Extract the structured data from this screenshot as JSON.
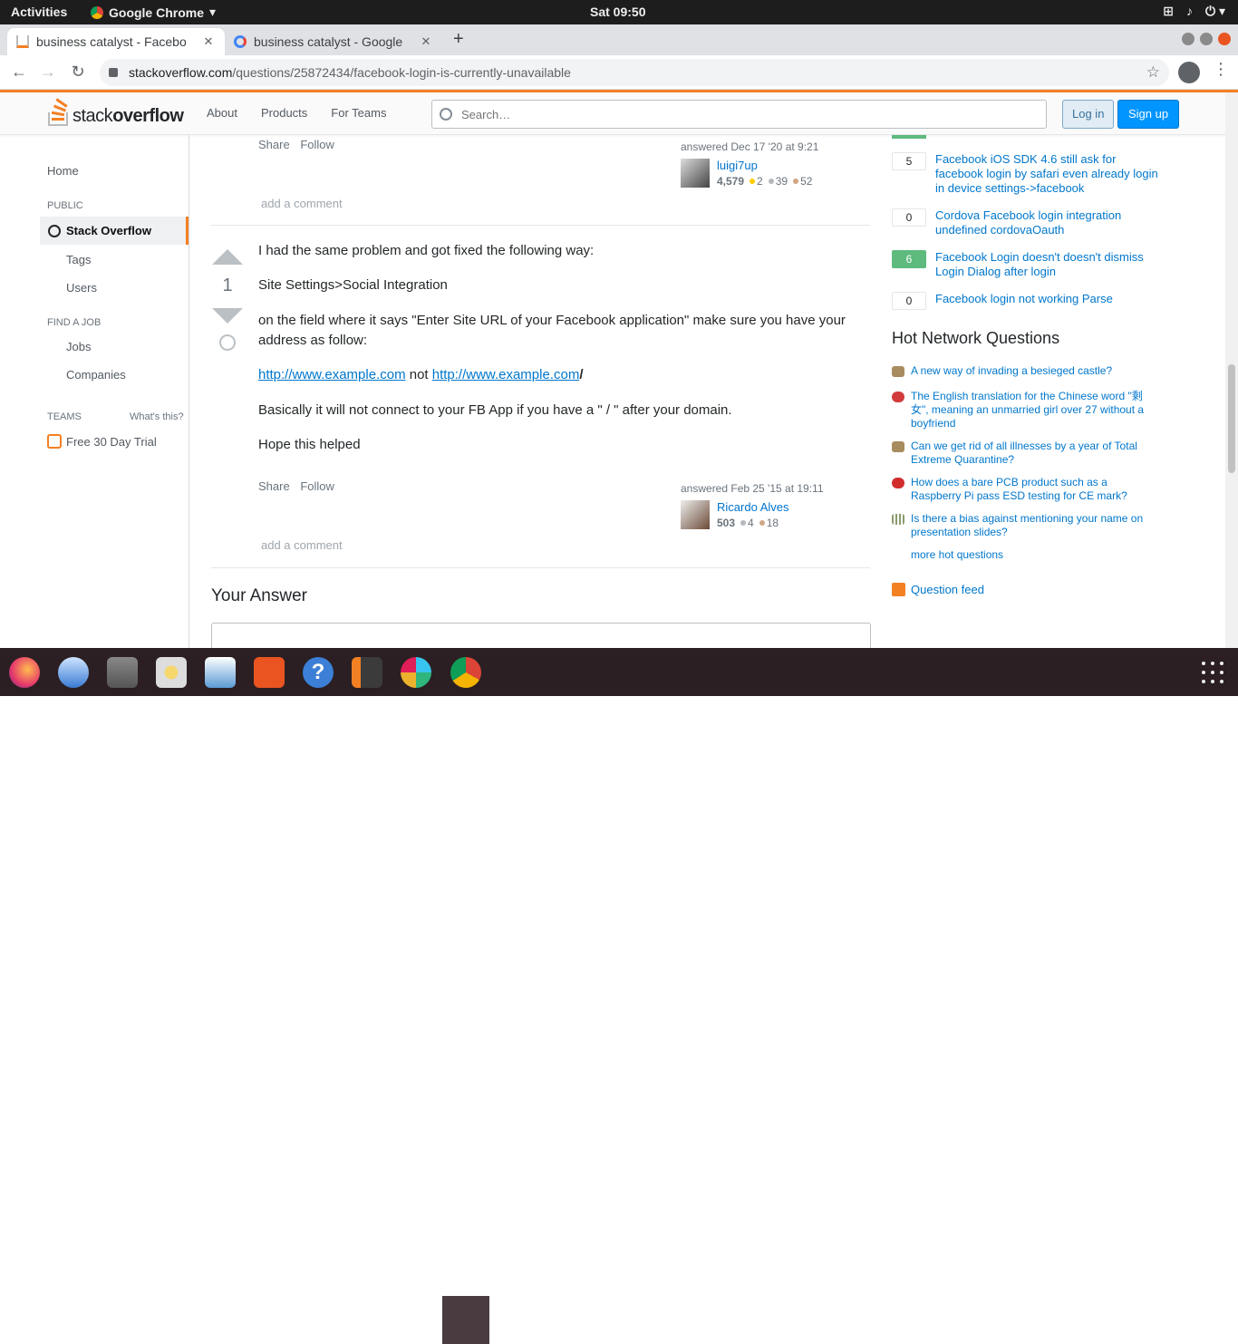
{
  "system": {
    "activities": "Activities",
    "app_name": "Google Chrome",
    "clock": "Sat 09:50"
  },
  "browser": {
    "tabs": [
      {
        "title": "business catalyst - Facebo",
        "active": true
      },
      {
        "title": "business catalyst - Google",
        "active": false
      }
    ],
    "url_host": "stackoverflow.com",
    "url_path": "/questions/25872434/facebook-login-is-currently-unavailable"
  },
  "so_header": {
    "logo_stack": "stack",
    "logo_overflow": "overflow",
    "nav": [
      "About",
      "Products",
      "For Teams"
    ],
    "search_placeholder": "Search…",
    "login": "Log in",
    "signup": "Sign up"
  },
  "leftnav": {
    "home": "Home",
    "public": "PUBLIC",
    "stack_overflow": "Stack Overflow",
    "tags": "Tags",
    "users": "Users",
    "find_job": "FIND A JOB",
    "jobs": "Jobs",
    "companies": "Companies",
    "teams": "TEAMS",
    "whats_this": "What's this?",
    "trial": "Free 30 Day Trial"
  },
  "answer_prev": {
    "share": "Share",
    "follow": "Follow",
    "answered": "answered Dec 17 '20 at 9:21",
    "user": "luigi7up",
    "rep": "4,579",
    "gold": "2",
    "silver": "39",
    "bronze": "52",
    "add_comment": "add a comment"
  },
  "answer": {
    "votes": "1",
    "p1": "I had the same problem and got fixed the following way:",
    "p2": "Site Settings>Social Integration",
    "p3": "on the field where it says \"Enter Site URL of your Facebook application\" make sure you have your address as follow:",
    "link1": "http://www.example.com",
    "not": " not ",
    "link2": "http://www.example.com",
    "slash": "/",
    "p5": "Basically it will not connect to your FB App if you have a \" / \" after your domain.",
    "p6": "Hope this helped",
    "share": "Share",
    "follow": "Follow",
    "answered": "answered Feb 25 '15 at 19:11",
    "user": "Ricardo Alves",
    "rep": "503",
    "silver": "4",
    "bronze": "18",
    "add_comment": "add a comment"
  },
  "your_answer": "Your Answer",
  "related": [
    {
      "score": "5",
      "title": "Facebook iOS SDK 4.6 still ask for facebook login by safari even already login in device settings->facebook",
      "accepted": false
    },
    {
      "score": "0",
      "title": "Cordova Facebook login integration undefined cordovaOauth",
      "accepted": false
    },
    {
      "score": "6",
      "title": "Facebook Login doesn't doesn't dismiss Login Dialog after login",
      "accepted": true
    },
    {
      "score": "0",
      "title": "Facebook login not working Parse",
      "accepted": false
    }
  ],
  "hot_network": {
    "title": "Hot Network Questions",
    "items": [
      {
        "title": "A new way of invading a besieged castle?",
        "icon": "worldbuilding-icon",
        "color": "#a88b5f"
      },
      {
        "title": "The English translation for the Chinese word \"剩女\", meaning an unmarried girl over 27 without a boyfriend",
        "icon": "chinese-icon",
        "color": "#d23b3b"
      },
      {
        "title": "Can we get rid of all illnesses by a year of Total Extreme Quarantine?",
        "icon": "worldbuilding-icon",
        "color": "#a88b5f"
      },
      {
        "title": "How does a bare PCB product such as a Raspberry Pi pass ESD testing for CE mark?",
        "icon": "electronics-icon",
        "color": "#d22d2d"
      },
      {
        "title": "Is there a bias against mentioning your name on presentation slides?",
        "icon": "academia-icon",
        "color": "#8a9a6a"
      }
    ],
    "more": "more hot questions"
  },
  "feed": "Question feed"
}
